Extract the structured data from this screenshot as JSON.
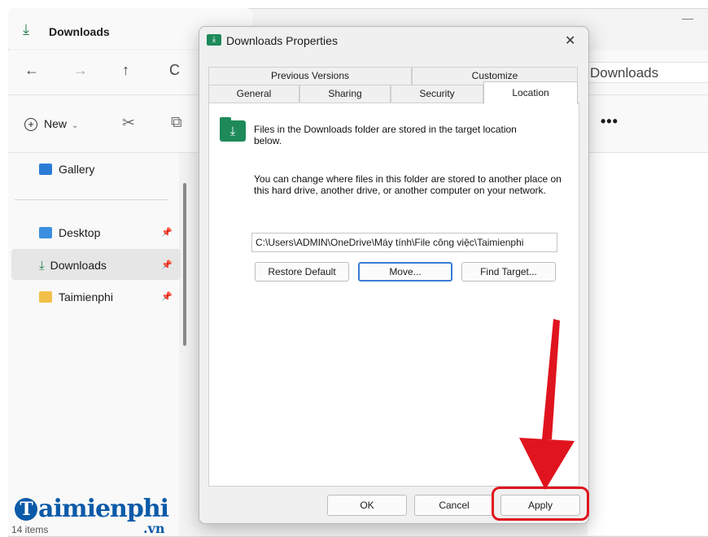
{
  "explorer": {
    "tab_title": "Downloads",
    "address_fragment": "Downloads",
    "toolbar": {
      "new_label": "New"
    },
    "sidebar": {
      "gallery": "Gallery",
      "items": [
        {
          "label": "Desktop"
        },
        {
          "label": "Downloads"
        },
        {
          "label": "Taimienphi"
        }
      ]
    },
    "status": "14 items"
  },
  "dialog": {
    "title": "Downloads Properties",
    "tabs_back": [
      "Previous Versions",
      "Customize"
    ],
    "tabs_front": [
      "General",
      "Sharing",
      "Security",
      "Location"
    ],
    "active_tab": "Location",
    "info_line": "Files in the Downloads folder are stored in the target location below.",
    "description": "You can change where files in this folder are stored to another place on this hard drive, another drive, or another computer on your network.",
    "path_value": "C:\\Users\\ADMIN\\OneDrive\\Máy tính\\File công việc\\Taimienphi",
    "buttons": {
      "restore_default": "Restore Default",
      "move": "Move...",
      "find_target": "Find Target...",
      "ok": "OK",
      "cancel": "Cancel",
      "apply": "Apply"
    }
  },
  "watermark": {
    "brand": "aimienphi",
    "brand_initial": "T",
    "suffix": ".vn"
  },
  "colors": {
    "accent_red": "#e0141e",
    "folder_green": "#1e8a5a",
    "brand_blue": "#0b5aa8"
  },
  "icons": [
    "download-icon",
    "back-arrow-icon",
    "forward-arrow-icon",
    "up-arrow-icon",
    "refresh-icon",
    "plus-circle-icon",
    "cut-icon",
    "copy-icon",
    "more-icon",
    "gallery-icon",
    "desktop-icon",
    "folder-icon",
    "pin-icon",
    "close-icon"
  ]
}
